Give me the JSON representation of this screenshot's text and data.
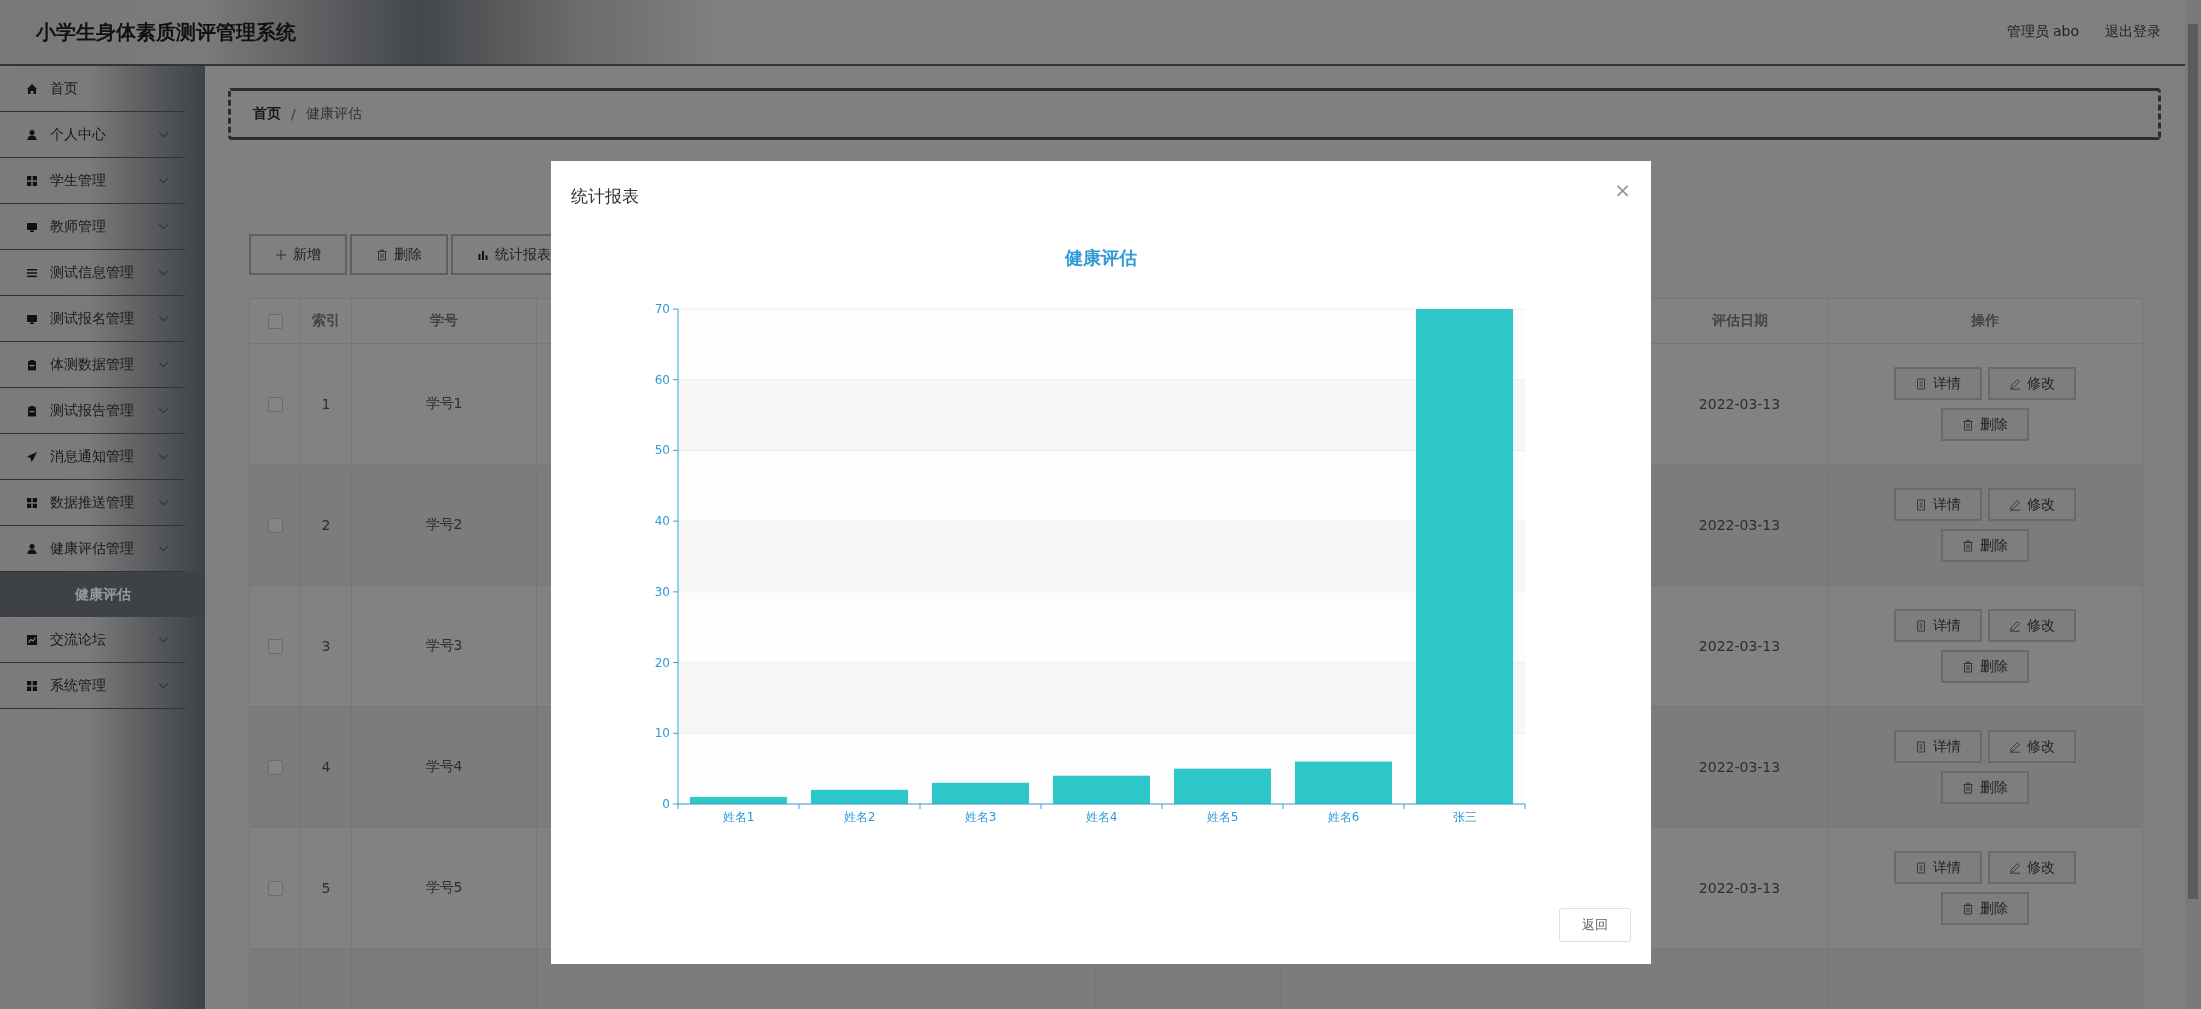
{
  "header": {
    "title": "小学生身体素质测评管理系统",
    "user": "管理员 abo",
    "logout": "退出登录"
  },
  "sidebar": {
    "items": [
      {
        "label": "首页"
      },
      {
        "label": "个人中心"
      },
      {
        "label": "学生管理"
      },
      {
        "label": "教师管理"
      },
      {
        "label": "测试信息管理"
      },
      {
        "label": "测试报名管理"
      },
      {
        "label": "体测数据管理"
      },
      {
        "label": "测试报告管理"
      },
      {
        "label": "消息通知管理"
      },
      {
        "label": "数据推送管理"
      },
      {
        "label": "健康评估管理",
        "children": [
          {
            "label": "健康评估",
            "selected": true
          }
        ]
      },
      {
        "label": "交流论坛"
      },
      {
        "label": "系统管理"
      }
    ]
  },
  "breadcrumb": {
    "items": [
      "首页",
      "健康评估"
    ],
    "separator": "/"
  },
  "toolbar": [
    "新增",
    "删除",
    "统计报表"
  ],
  "table": {
    "select_all_checked": false,
    "columns": [
      "索引",
      "学号",
      "评估日期",
      "操作"
    ],
    "rows": [
      {
        "checked": false,
        "index": "1",
        "student_no": "学号1",
        "date": "2022-03-13",
        "actions": [
          "详情",
          "修改",
          "删除"
        ]
      },
      {
        "checked": false,
        "index": "2",
        "student_no": "学号2",
        "date": "2022-03-13",
        "actions": [
          "详情",
          "修改",
          "删除"
        ]
      },
      {
        "checked": false,
        "index": "3",
        "student_no": "学号3",
        "date": "2022-03-13",
        "actions": [
          "详情",
          "修改",
          "删除"
        ]
      },
      {
        "checked": false,
        "index": "4",
        "student_no": "学号4",
        "date": "2022-03-13",
        "actions": [
          "详情",
          "修改",
          "删除"
        ]
      },
      {
        "checked": false,
        "index": "5",
        "student_no": "学号5",
        "date": "2022-03-13",
        "actions": [
          "详情",
          "修改",
          "删除"
        ]
      }
    ]
  },
  "dialog": {
    "title": "统计报表",
    "close": "×",
    "back_button": "返回",
    "chart_data": {
      "type": "bar",
      "title": "健康评估",
      "categories": [
        "姓名1",
        "姓名2",
        "姓名3",
        "姓名4",
        "姓名5",
        "姓名6",
        "张三"
      ],
      "series": [
        {
          "color": "#2ec7c9",
          "values": [
            1,
            2,
            3,
            4,
            5,
            6,
            70
          ]
        }
      ],
      "ylim": [
        0,
        70
      ],
      "yticks": [
        0,
        10,
        20,
        30,
        40,
        50,
        60,
        70
      ],
      "grid": true
    }
  }
}
